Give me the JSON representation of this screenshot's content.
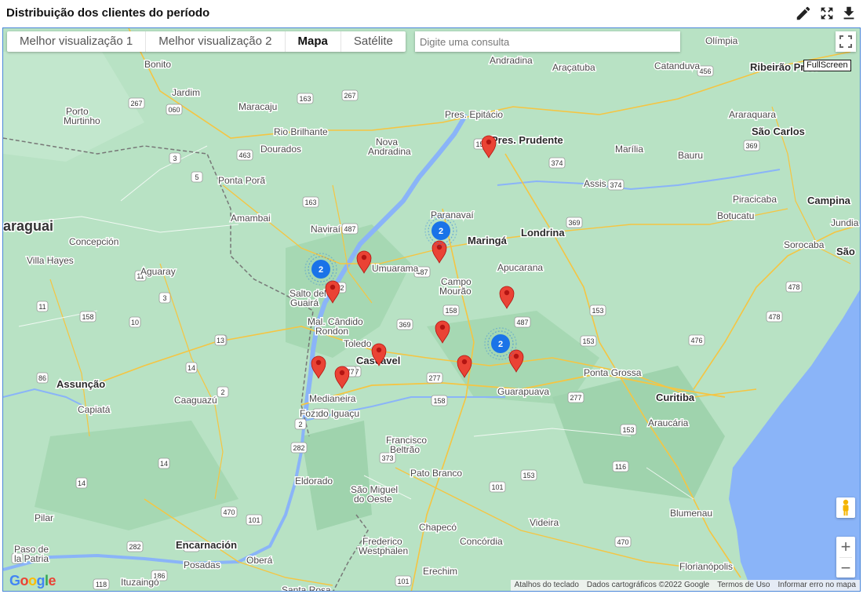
{
  "panel": {
    "title": "Distribuição dos clientes do período",
    "icons": [
      "pencil-icon",
      "expand-icon",
      "download-icon"
    ]
  },
  "map": {
    "tabs": [
      {
        "label": "Melhor visualização 1",
        "active": false
      },
      {
        "label": "Melhor visualização 2",
        "active": false
      },
      {
        "label": "Mapa",
        "active": true
      },
      {
        "label": "Satélite",
        "active": false
      }
    ],
    "search": {
      "placeholder": "Digite uma consulta",
      "value": ""
    },
    "fullscreen_label": "FullScreen",
    "google_logo": "Google",
    "attribution": [
      "Atalhos do teclado",
      "Dados cartográficos ©2022 Google",
      "Termos de Uso",
      "Informar erro no mapa"
    ],
    "zoom_in": "+",
    "zoom_out": "−",
    "colors": {
      "land": "#b8e2c4",
      "water": "#8ab4f8",
      "road": "#f5c542",
      "marker": "#ea4335",
      "cluster": "#1a73e8"
    },
    "countries": [
      {
        "name": "araguai"
      }
    ],
    "cities": [
      {
        "name": "Olímpia"
      },
      {
        "name": "Andradina"
      },
      {
        "name": "Araçatuba"
      },
      {
        "name": "Catanduva"
      },
      {
        "name": "Ribeirão Preto"
      },
      {
        "name": "Bonito"
      },
      {
        "name": "Jardim"
      },
      {
        "name": "Maracaju"
      },
      {
        "name": "Porto"
      },
      {
        "name": "Murtinho"
      },
      {
        "name": "Rio Brilhante"
      },
      {
        "name": "Pres. Epitácio"
      },
      {
        "name": "Araraquara"
      },
      {
        "name": "São Carlos"
      },
      {
        "name": "Nova"
      },
      {
        "name": "Andradina"
      },
      {
        "name": "Pres. Prudente"
      },
      {
        "name": "Dourados"
      },
      {
        "name": "Marília"
      },
      {
        "name": "Bauru"
      },
      {
        "name": "Ponta Porã"
      },
      {
        "name": "Assis"
      },
      {
        "name": "Piracicaba"
      },
      {
        "name": "Campina"
      },
      {
        "name": "Jundia"
      },
      {
        "name": "Amambai"
      },
      {
        "name": "Paranavaí"
      },
      {
        "name": "Botucatu"
      },
      {
        "name": "Naviraí"
      },
      {
        "name": "Londrina"
      },
      {
        "name": "Concepción"
      },
      {
        "name": "Maringá"
      },
      {
        "name": "Sorocaba"
      },
      {
        "name": "São"
      },
      {
        "name": "Villa Hayes"
      },
      {
        "name": "Umuarama"
      },
      {
        "name": "Apucarana"
      },
      {
        "name": "Aguaray"
      },
      {
        "name": "Campo"
      },
      {
        "name": "Mourão"
      },
      {
        "name": "Salto del"
      },
      {
        "name": "Guairá"
      },
      {
        "name": "Mal. Cândido"
      },
      {
        "name": "Rondon"
      },
      {
        "name": "Toledo"
      },
      {
        "name": "Cascavel"
      },
      {
        "name": "Ponta Grossa"
      },
      {
        "name": "Assunção"
      },
      {
        "name": "Curitiba"
      },
      {
        "name": "Capiatá"
      },
      {
        "name": "Caaguazú"
      },
      {
        "name": "Medianeira"
      },
      {
        "name": "Foz do Iguaçu"
      },
      {
        "name": "Guarapuava"
      },
      {
        "name": "Araucária"
      },
      {
        "name": "Francisco"
      },
      {
        "name": "Beltrão"
      },
      {
        "name": "Eldorado"
      },
      {
        "name": "Pato Branco"
      },
      {
        "name": "São Miguel"
      },
      {
        "name": "do Oeste"
      },
      {
        "name": "Blumenau"
      },
      {
        "name": "Pilar"
      },
      {
        "name": "Chapecó"
      },
      {
        "name": "Videira"
      },
      {
        "name": "Encarnación"
      },
      {
        "name": "Paso de"
      },
      {
        "name": "la Patria"
      },
      {
        "name": "Posadas"
      },
      {
        "name": "Oberá"
      },
      {
        "name": "Frederico"
      },
      {
        "name": "Westphalen"
      },
      {
        "name": "Concórdia"
      },
      {
        "name": "Erechim"
      },
      {
        "name": "Florianópolis"
      },
      {
        "name": "Ituzaingó"
      },
      {
        "name": "Santa Rosa"
      }
    ],
    "highway_shields": [
      "150",
      "456",
      "267",
      "163",
      "267",
      "060",
      "463",
      "374",
      "369",
      "3",
      "5",
      "163",
      "487",
      "374",
      "369",
      "487",
      "272",
      "158",
      "487",
      "369",
      "153",
      "3",
      "11",
      "10",
      "13",
      "11",
      "478",
      "478",
      "13",
      "153",
      "476",
      "277",
      "277",
      "158",
      "86",
      "2",
      "14",
      "158",
      "277",
      "2",
      "277",
      "101",
      "116",
      "373",
      "282",
      "153",
      "101",
      "153",
      "470",
      "14",
      "14",
      "282",
      "116",
      "470",
      "101",
      "2",
      "118",
      "186",
      "101"
    ],
    "markers": [
      {
        "type": "pin"
      },
      {
        "type": "pin"
      },
      {
        "type": "pin"
      },
      {
        "type": "pin"
      },
      {
        "type": "pin"
      },
      {
        "type": "pin"
      },
      {
        "type": "pin"
      },
      {
        "type": "pin"
      },
      {
        "type": "pin"
      },
      {
        "type": "pin"
      },
      {
        "type": "pin"
      }
    ],
    "clusters": [
      {
        "count": "2"
      },
      {
        "count": "2"
      },
      {
        "count": "2"
      }
    ]
  }
}
